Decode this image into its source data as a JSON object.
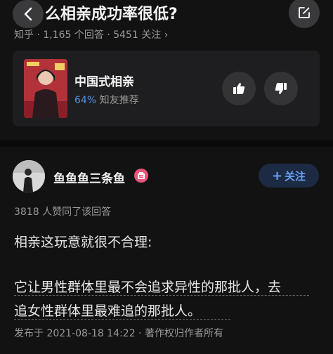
{
  "question": {
    "title": "么相亲成功率很低?",
    "meta": "知乎 · 1,165 个回答 · 5451 关注 ›"
  },
  "card": {
    "title": "中国式相亲",
    "percent": "64%",
    "recommend": "知友推荐"
  },
  "answer": {
    "author": "鱼鱼鱼三条鱼",
    "follow_label": "关注",
    "follow_plus": "+",
    "agree_count": "3818 人赞同了该回答",
    "paragraphs": [
      "相亲这玩意就很不合理:",
      "它让男性群体里最不会追求异性的那批人，去",
      "追女性群体里最难追的那批人。"
    ],
    "footer": "发布于 2021-08-18 14:22 · 著作权归作者所有"
  },
  "colors": {
    "background": "#121212",
    "card": "#1e1e20",
    "accent": "#4d8fea",
    "badge": "#e6567a"
  },
  "icons": {
    "back": "chevron-left-icon",
    "edit": "edit-icon",
    "thumbs_up": "thumbs-up-icon",
    "thumbs_down": "thumbs-down-icon",
    "badge": "member-badge-icon"
  }
}
